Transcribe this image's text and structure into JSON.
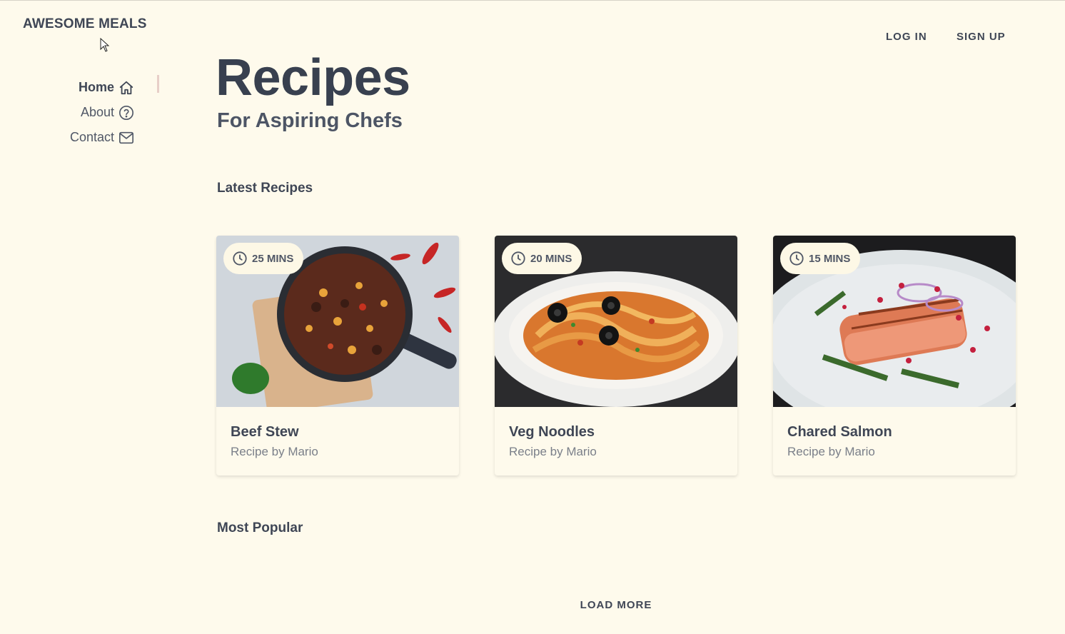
{
  "brand": "AWESOME MEALS",
  "nav": {
    "items": [
      {
        "label": "Home",
        "icon": "home-icon",
        "active": true
      },
      {
        "label": "About",
        "icon": "question-circle-icon",
        "active": false
      },
      {
        "label": "Contact",
        "icon": "mail-icon",
        "active": false
      }
    ]
  },
  "auth": {
    "login": "LOG IN",
    "signup": "SIGN UP"
  },
  "hero": {
    "title": "Recipes",
    "subtitle": "For Aspiring Chefs"
  },
  "sections": {
    "latest": "Latest Recipes",
    "popular": "Most Popular"
  },
  "recipes": [
    {
      "time": "25 MINS",
      "title": "Beef Stew",
      "author": "Recipe by Mario"
    },
    {
      "time": "20 MINS",
      "title": "Veg Noodles",
      "author": "Recipe by Mario"
    },
    {
      "time": "15 MINS",
      "title": "Chared Salmon",
      "author": "Recipe by Mario"
    }
  ],
  "load_more": "LOAD MORE",
  "colors": {
    "background": "#fefaec",
    "text": "#3f4655",
    "muted": "#7a7f89",
    "active_indicator": "#e8cfc8"
  }
}
